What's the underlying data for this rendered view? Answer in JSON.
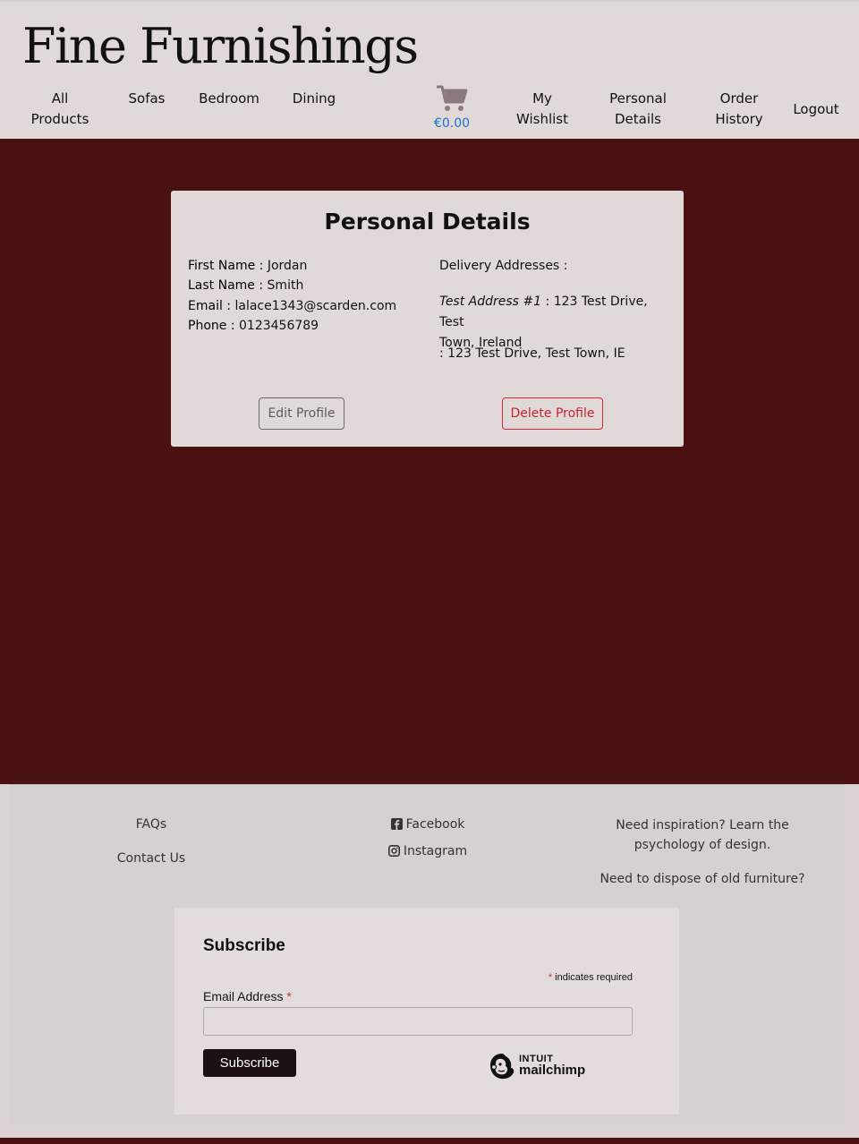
{
  "brand": "Fine Furnishings",
  "nav": {
    "all_products": [
      "All",
      "Products"
    ],
    "sofas": "Sofas",
    "bedroom": "Bedroom",
    "dining": "Dining",
    "cart_total": "€0.00",
    "wishlist": [
      "My",
      "Wishlist"
    ],
    "personal_details": [
      "Personal",
      "Details"
    ],
    "order_history": [
      "Order",
      "History"
    ],
    "logout": "Logout"
  },
  "profile": {
    "title": "Personal Details",
    "first_name_label": "First Name :",
    "first_name": "Jordan",
    "last_name_label": "Last Name :",
    "last_name": "Smith",
    "email_label": "Email :",
    "email": "lalace1343@scarden.com",
    "phone_label": "Phone :",
    "phone": "0123456789",
    "addresses_label": "Delivery Addresses :",
    "addresses": [
      {
        "name": "Test Address #1",
        "line1": ": 123 Test Drive, Test",
        "line2": "Town, Ireland"
      },
      {
        "name": "",
        "line1": ": 123 Test Drive, Test Town, IE"
      }
    ],
    "edit_button": "Edit Profile",
    "delete_button": "Delete Profile"
  },
  "footer": {
    "faqs": "FAQs",
    "contact": "Contact Us",
    "facebook": "Facebook",
    "instagram": "Instagram",
    "inspiration_line1": "Need inspiration? Learn the",
    "inspiration_line2": "psychology of design.",
    "dispose": "Need to dispose of old furniture?"
  },
  "subscribe": {
    "title": "Subscribe",
    "required_note": "indicates required",
    "asterisk": "*",
    "email_label": "Email Address",
    "email_value": "",
    "button": "Subscribe",
    "logo_top": "INTUIT",
    "logo_bottom": "mailchimp"
  },
  "colors": {
    "page_bg": "#4a1111",
    "header_bg": "#e1d8d8",
    "cart_icon": "#8a7a7c",
    "cart_total": "#1a6fd0",
    "danger": "#c82333"
  },
  "icons": {
    "cart": "shopping-cart-icon",
    "facebook": "facebook-icon",
    "instagram": "instagram-icon",
    "mailchimp": "mailchimp-logo"
  }
}
